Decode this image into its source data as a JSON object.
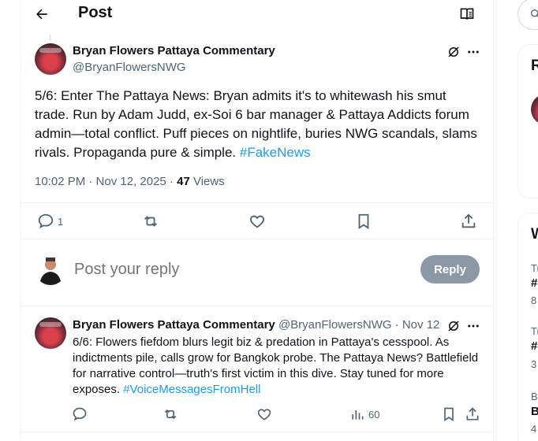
{
  "header": {
    "title": "Post"
  },
  "main_post": {
    "author_name": "Bryan Flowers Pattaya Commentary",
    "author_handle": "@BryanFlowersNWG",
    "text": "5/6: Enter The Pattaya News: Bryan admits it's to whitewash his smut trade. Run by Adam Judd, ex-Soi 6 bar manager & Pattaya Addicts forum admin—total conflict. Puff pieces on nightlife, buries NWG scandals, slams rivals. Propaganda pure & simple. ",
    "hashtag": "#FakeNews",
    "timestamp": "10:02 PM · Nov 12, 2025 · ",
    "views_count": "47",
    "views_label": " Views",
    "reply_count": "1"
  },
  "reply_composer": {
    "placeholder": "Post your reply",
    "button_label": "Reply"
  },
  "reply_post": {
    "author_name": "Bryan Flowers Pattaya Commentary",
    "author_handle": "@BryanFlowersNWG",
    "date": " · Nov 12",
    "text": "6/6: Flowers fiefdom blurs legit biz & predation in Pattaya's cesspool. As indictments pile, calls grow for Bangkok probe. The Pattaya News? Battlefield for narrative control—truth's first victim in this dive. Stay tuned for more exposes. ",
    "hashtag": "#VoiceMessagesFromHell",
    "views": "60"
  },
  "sidebar": {
    "card1_heading": "R",
    "card2_heading": "W",
    "trend_letters": [
      "Tr",
      "#",
      "8",
      "Tr",
      "#",
      "3",
      "B",
      "B",
      "4"
    ]
  },
  "colors": {
    "accent": "#1d9bf0",
    "muted": "#536471",
    "reply_button_bg": "#8b98a5"
  }
}
